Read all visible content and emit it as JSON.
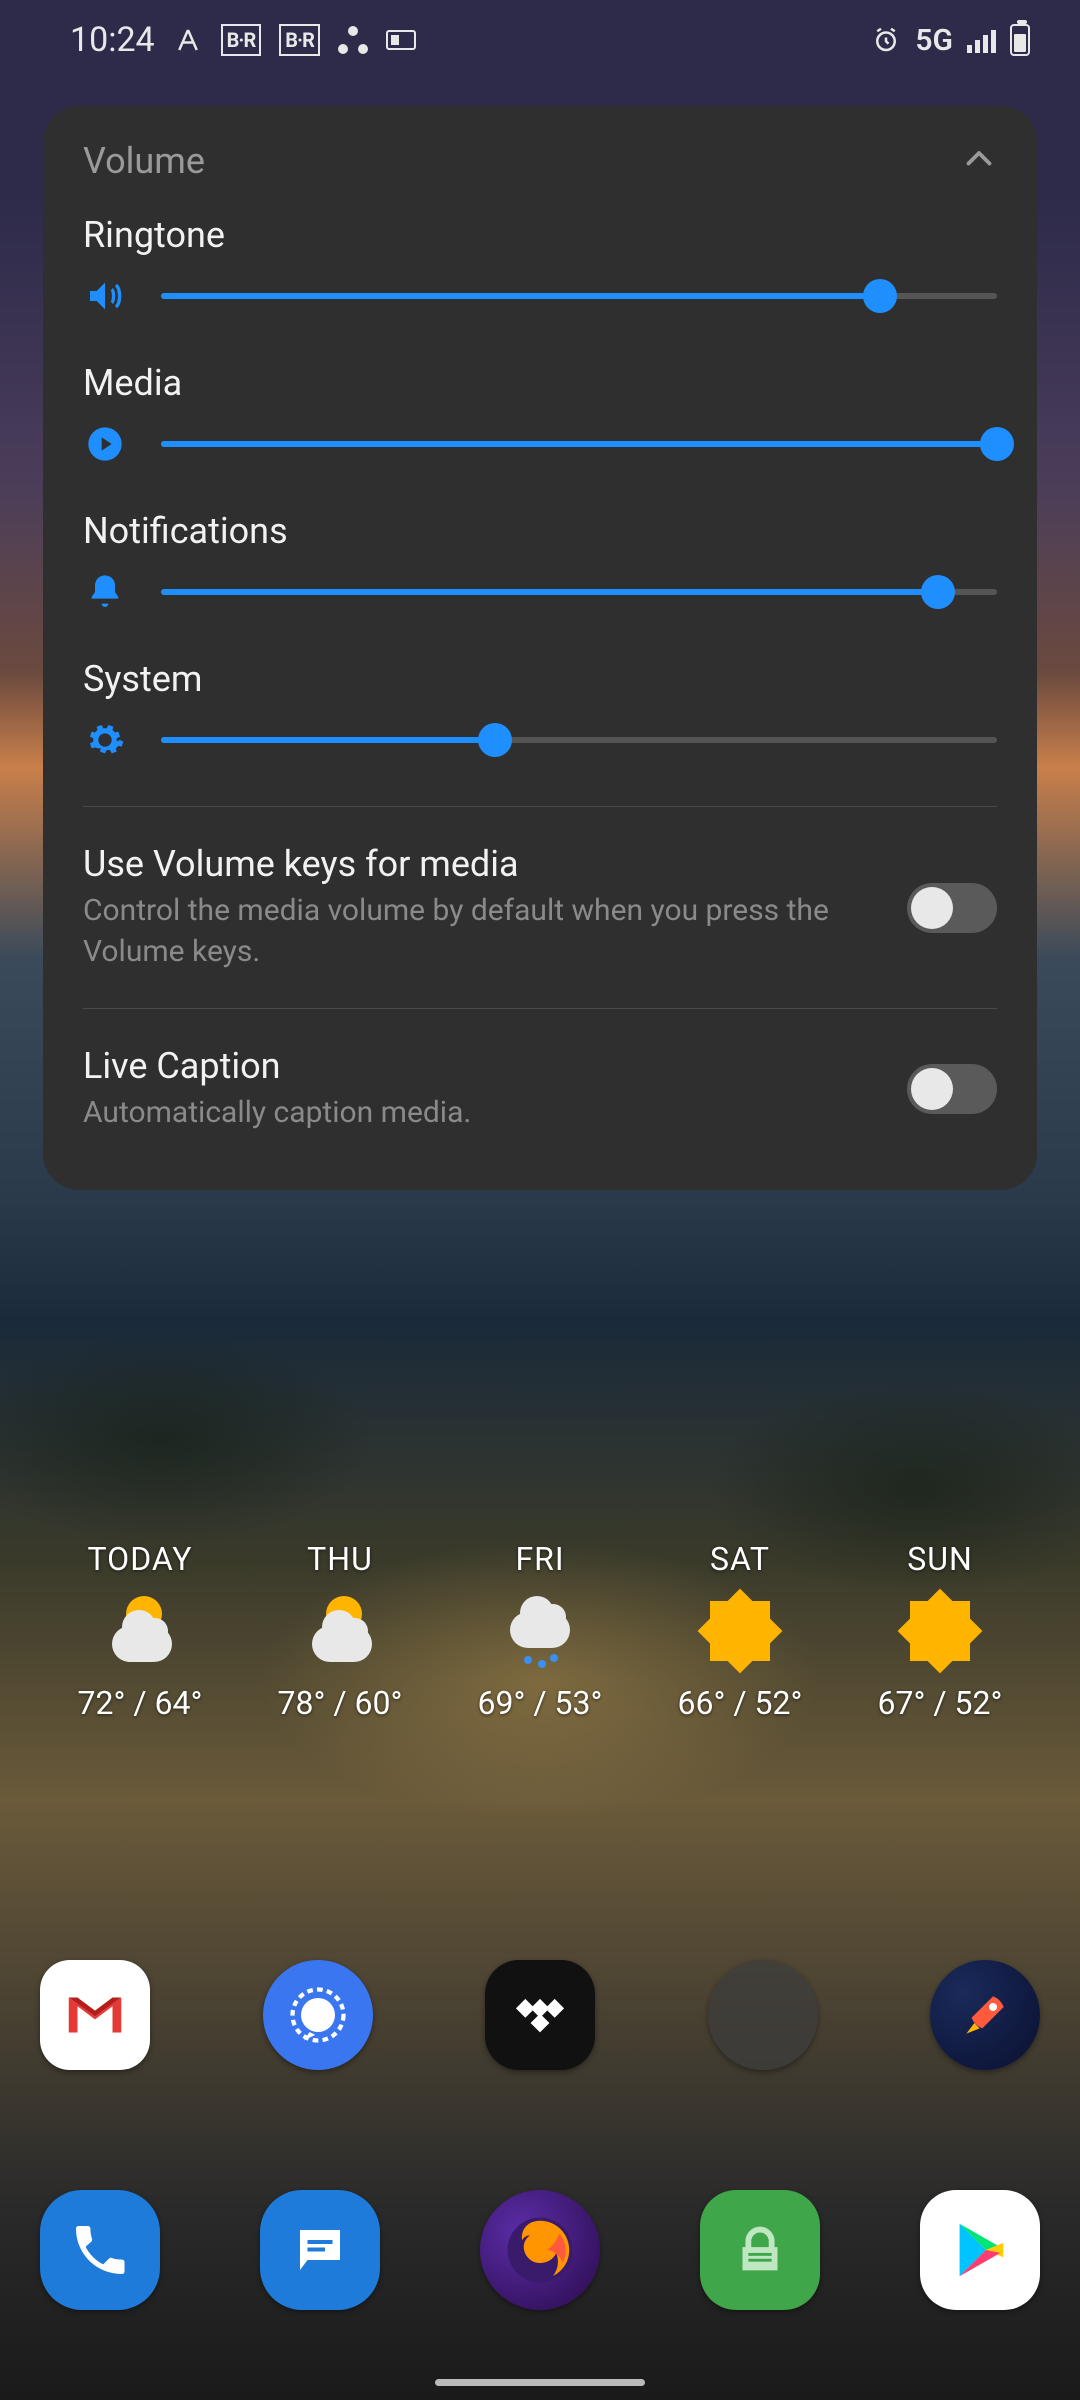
{
  "status": {
    "time": "10:24",
    "network_label": "5G"
  },
  "volume_panel": {
    "title": "Volume",
    "sliders": {
      "ringtone": {
        "label": "Ringtone",
        "percent": 86
      },
      "media": {
        "label": "Media",
        "percent": 100
      },
      "notifications": {
        "label": "Notifications",
        "percent": 93
      },
      "system": {
        "label": "System",
        "percent": 40
      }
    },
    "settings": {
      "volume_keys_media": {
        "title": "Use Volume keys for media",
        "desc": "Control the media volume by default when you press the Volume keys.",
        "enabled": false
      },
      "live_caption": {
        "title": "Live Caption",
        "desc": "Automatically caption media.",
        "enabled": false
      }
    }
  },
  "weather": {
    "days": [
      {
        "label": "TODAY",
        "temps": "72° / 64°",
        "icon": "partly-cloudy"
      },
      {
        "label": "THU",
        "temps": "78° / 60°",
        "icon": "partly-cloudy"
      },
      {
        "label": "FRI",
        "temps": "69° / 53°",
        "icon": "rain"
      },
      {
        "label": "SAT",
        "temps": "66° / 52°",
        "icon": "sunny"
      },
      {
        "label": "SUN",
        "temps": "67° / 52°",
        "icon": "sunny"
      }
    ]
  },
  "apps": {
    "row1": [
      "Gmail",
      "Signal",
      "Tidal",
      "Google Folder",
      "Rocket"
    ],
    "dock": [
      "Phone",
      "Messages",
      "Firefox",
      "Authenticator",
      "Play Store"
    ]
  },
  "colors": {
    "accent": "#1f8fff",
    "panel_bg": "#2f2f2f"
  }
}
